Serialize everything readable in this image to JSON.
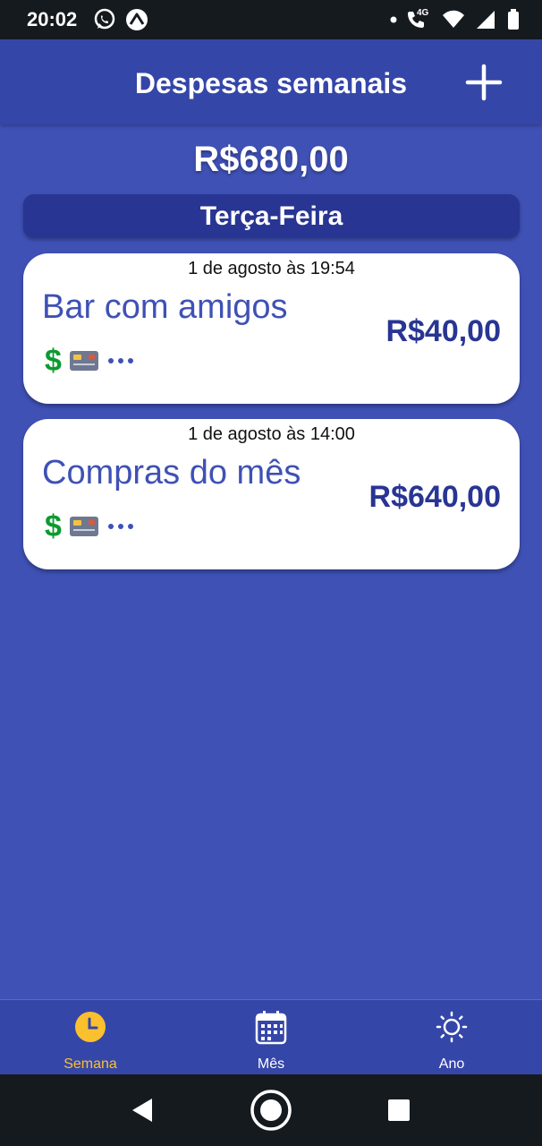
{
  "status_bar": {
    "time": "20:02",
    "network_label": "4G"
  },
  "app_bar": {
    "title": "Despesas semanais",
    "add_icon": "plus-icon"
  },
  "summary": {
    "total": "R$680,00"
  },
  "day_group": {
    "label": "Terça-Feira"
  },
  "expenses": [
    {
      "time": "1 de agosto às 19:54",
      "title": "Bar com amigos",
      "amount": "R$40,00",
      "icons": [
        "dollar-icon",
        "credit-card-icon",
        "more-icon"
      ]
    },
    {
      "time": "1 de agosto às 14:00",
      "title": "Compras do mês",
      "amount": "R$640,00",
      "icons": [
        "dollar-icon",
        "credit-card-icon",
        "more-icon"
      ]
    }
  ],
  "bottom_nav": {
    "items": [
      {
        "label": "Semana",
        "icon": "clock-icon",
        "active": true
      },
      {
        "label": "Mês",
        "icon": "calendar-icon",
        "active": false
      },
      {
        "label": "Ano",
        "icon": "sun-icon",
        "active": false
      }
    ]
  },
  "colors": {
    "background": "#3f51b5",
    "app_bar": "#3546a9",
    "day_header": "#283593",
    "active_tab": "#fbc02d",
    "dollar": "#0d9a2f",
    "status_bar": "#151a1f"
  }
}
